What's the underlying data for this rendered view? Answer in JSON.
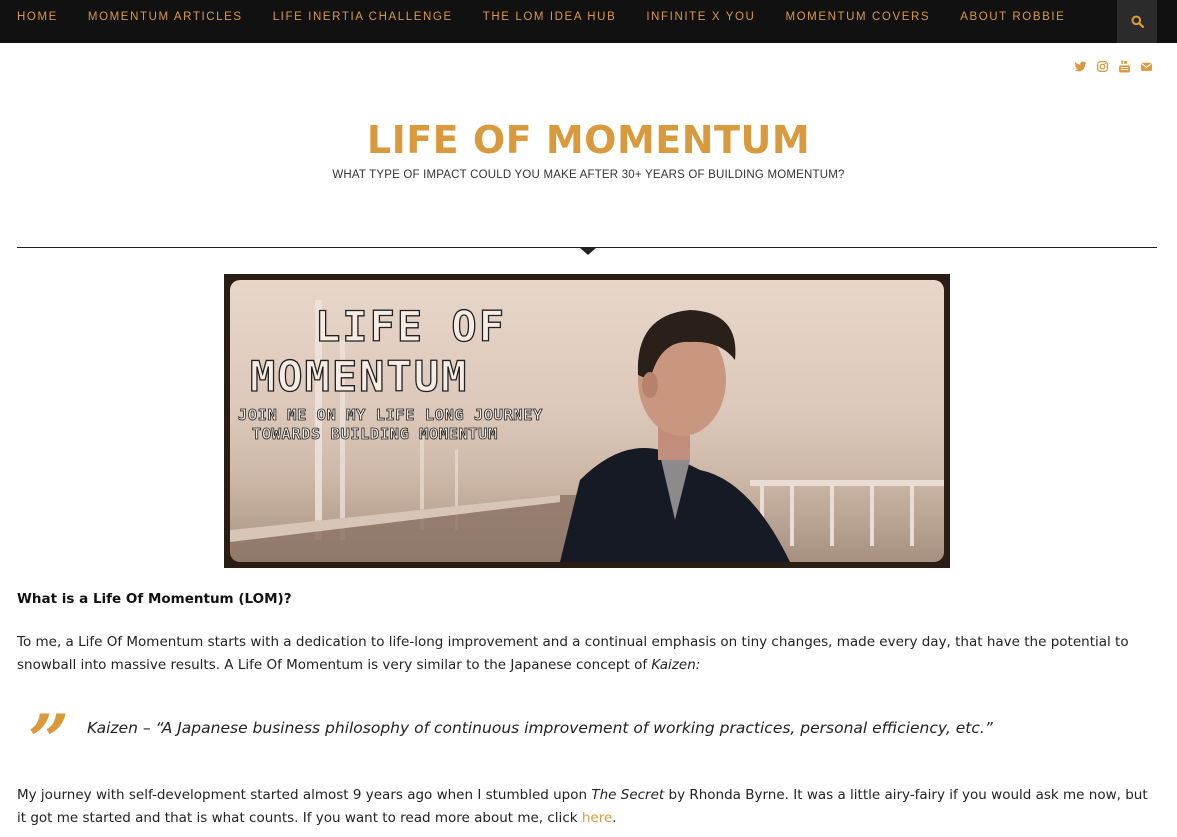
{
  "nav": {
    "items": [
      {
        "label": "HOME"
      },
      {
        "label": "MOMENTUM ARTICLES"
      },
      {
        "label": "LIFE INERTIA CHALLENGE"
      },
      {
        "label": "THE LOM IDEA HUB"
      },
      {
        "label": "INFINITE X YOU"
      },
      {
        "label": "MOMENTUM COVERS"
      },
      {
        "label": "ABOUT ROBBIE"
      }
    ],
    "search_icon": "search-icon"
  },
  "social": {
    "icons": [
      "twitter-icon",
      "instagram-icon",
      "youtube-icon",
      "envelope-icon"
    ]
  },
  "branding": {
    "title": "LIFE OF MOMENTUM",
    "tagline": "WHAT TYPE OF IMPACT COULD YOU MAKE AFTER 30+ YEARS OF BUILDING MOMENTUM?"
  },
  "banner": {
    "line1": "LIFE OF",
    "line2": "MOMENTUM",
    "line3": "JOIN ME ON MY LIFE LONG JOURNEY",
    "line4": "TOWARDS BUILDING MOMENTUM"
  },
  "content": {
    "heading": "What is a Life Of Momentum (LOM)?",
    "para1_text": "To me, a Life Of Momentum starts with a dedication to life-long improvement and a continual emphasis on tiny changes, made every day, that have the potential to snowball into massive results. A Life Of Momentum is very similar to the Japanese concept of ",
    "para1_em": "Kaizen:",
    "quote_mark": "”",
    "quote": "Kaizen – “A Japanese business philosophy of continuous improvement of working practices, personal efficiency, etc.”",
    "para2_a": "My journey with self-development started almost 9 years ago when I stumbled upon ",
    "para2_em": "The Secret",
    "para2_b": " by Rhonda Byrne. It was a little airy-fairy if you would ask me now, but it got me started and that is what counts. If you want to read more about me, click ",
    "para2_link": "here",
    "para2_c": "."
  },
  "colors": {
    "accent": "#d99a3d",
    "nav_bg": "#111111",
    "text": "#222222"
  }
}
